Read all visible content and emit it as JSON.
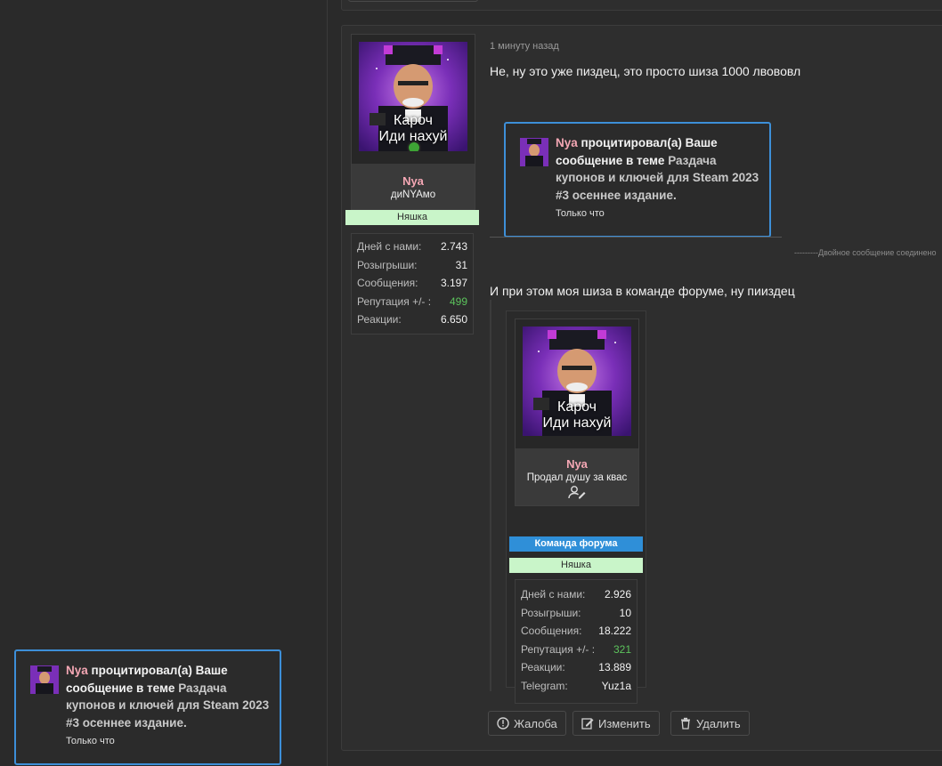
{
  "post": {
    "time": "1 минуту назад",
    "text1": "Не, ну это уже пиздец, это просто шиза 1000 лвововл",
    "double_note": "---------Двойное сообщение соединено",
    "text2": "И при этом моя шиза в команде форуме, ну пииздец",
    "actions": {
      "report": "Жалоба",
      "edit": "Изменить",
      "delete": "Удалить"
    }
  },
  "author": {
    "name": "Nya",
    "title": "диNYAмо",
    "banner": "Няшка",
    "avatar_caption_1": "Кароч",
    "avatar_caption_2": "Иди нахуй",
    "stats": [
      {
        "label": "Дней с нами:",
        "value": "2.743"
      },
      {
        "label": "Розыгрыши:",
        "value": "31"
      },
      {
        "label": "Сообщения:",
        "value": "3.197"
      },
      {
        "label": "Репутация +/- :",
        "value": "499"
      },
      {
        "label": "Реакции:",
        "value": "6.650"
      }
    ]
  },
  "notification": {
    "user": "Nya",
    "action": " процитировал(а) Ваше сообщение в теме ",
    "thread": "Раздача купонов и ключей для Steam 2023 #3 осеннее издание.",
    "time": "Только что"
  },
  "embedded_user": {
    "name": "Nya",
    "title": "Продал душу за квас",
    "banner_team": "Команда форума",
    "banner": "Няшка",
    "avatar_caption_1": "Кароч",
    "avatar_caption_2": "Иди нахуй",
    "stats": [
      {
        "label": "Дней с нами:",
        "value": "2.926"
      },
      {
        "label": "Розыгрыши:",
        "value": "10"
      },
      {
        "label": "Сообщения:",
        "value": "18.222"
      },
      {
        "label": "Репутация +/- :",
        "value": "321"
      },
      {
        "label": "Реакции:",
        "value": "13.889"
      },
      {
        "label": "Telegram:",
        "value": "Yuz1a"
      }
    ]
  },
  "colors": {
    "username": "#f4a7b4",
    "reputation": "#5cc35c",
    "notif_border": "#3d8fd8",
    "team_banner": "#2f8fd8",
    "nyashka_banner": "#c9f5c9"
  }
}
